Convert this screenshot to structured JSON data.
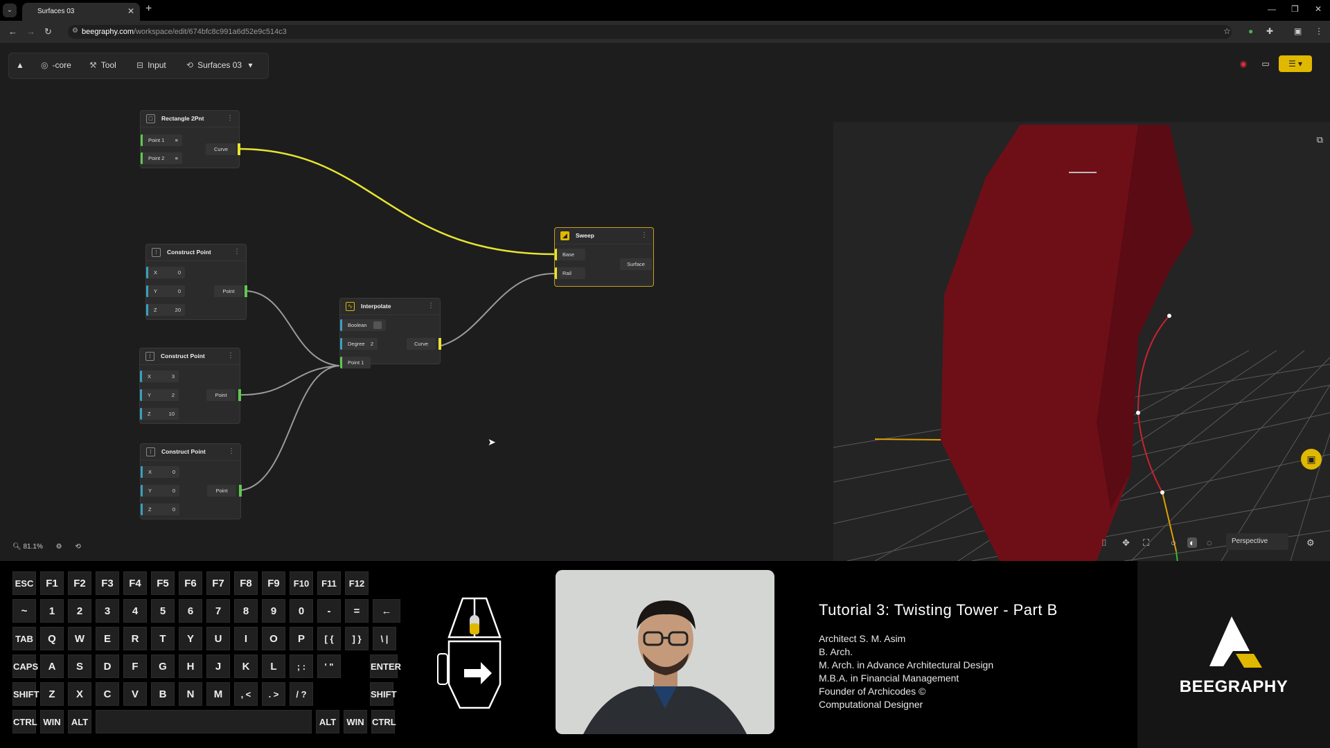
{
  "browser": {
    "tab_title": "Surfaces 03",
    "url_host": "beegraphy.com",
    "url_path": "/workspace/edit/674bfc8c991a6d52e9c514c3"
  },
  "toolbar": {
    "core_label": "-core",
    "tool_label": "Tool",
    "input_label": "Input",
    "project_label": "Surfaces 03"
  },
  "nodes": {
    "rect": {
      "title": "Rectangle 2Pnt",
      "p1": "Point 1",
      "p2": "Point 2",
      "out": "Curve"
    },
    "cp1": {
      "title": "Construct Point",
      "x_label": "X",
      "x": "0",
      "y_label": "Y",
      "y": "0",
      "z_label": "Z",
      "z": "20",
      "out": "Point"
    },
    "cp2": {
      "title": "Construct Point",
      "x_label": "X",
      "x": "3",
      "y_label": "Y",
      "y": "2",
      "z_label": "Z",
      "z": "10",
      "out": "Point"
    },
    "cp3": {
      "title": "Construct Point",
      "x_label": "X",
      "x": "0",
      "y_label": "Y",
      "y": "0",
      "z_label": "Z",
      "z": "0",
      "out": "Point"
    },
    "interp": {
      "title": "Interpolate",
      "boolean": "Boolean",
      "degree_label": "Degree",
      "degree": "2",
      "point": "Point 1",
      "out": "Curve"
    },
    "sweep": {
      "title": "Sweep",
      "base": "Base",
      "rail": "Rail",
      "out": "Surface"
    }
  },
  "viewport": {
    "camera": "Perspective"
  },
  "zoom": "81.1%",
  "keyboard": {
    "rows": [
      [
        "ESC",
        "F1",
        "F2",
        "F3",
        "F4",
        "F5",
        "F6",
        "F7",
        "F8",
        "F9",
        "F10",
        "F11",
        "F12"
      ],
      [
        "~",
        "1",
        "2",
        "3",
        "4",
        "5",
        "6",
        "7",
        "8",
        "9",
        "0",
        "-",
        "=",
        "←"
      ],
      [
        "TAB",
        "Q",
        "W",
        "E",
        "R",
        "T",
        "Y",
        "U",
        "I",
        "O",
        "P",
        "[ {",
        "] }",
        "\\ |"
      ],
      [
        "CAPS",
        "A",
        "S",
        "D",
        "F",
        "G",
        "H",
        "J",
        "K",
        "L",
        "; :",
        "' \"",
        "ENTER"
      ],
      [
        "SHIFT",
        "Z",
        "X",
        "C",
        "V",
        "B",
        "N",
        "M",
        ", <",
        ". >",
        "/ ?",
        "SHIFT"
      ],
      [
        "CTRL",
        "WIN",
        "ALT",
        "",
        "ALT",
        "WIN",
        "CTRL"
      ]
    ]
  },
  "info": {
    "title": "Tutorial 3: Twisting Tower - Part B",
    "lines": [
      "Architect S. M. Asim",
      "B. Arch.",
      "M. Arch. in Advance Architectural Design",
      "M.B.A. in Financial Management",
      "Founder of Archicodes ©",
      "Computational Designer"
    ]
  },
  "brand": {
    "name": "BEEGRAPHY"
  },
  "colors": {
    "wire_yellow": "#e7e531",
    "wire_gray": "#9a9a9a",
    "surface": "#6e0f18",
    "accent": "#e0b800"
  }
}
